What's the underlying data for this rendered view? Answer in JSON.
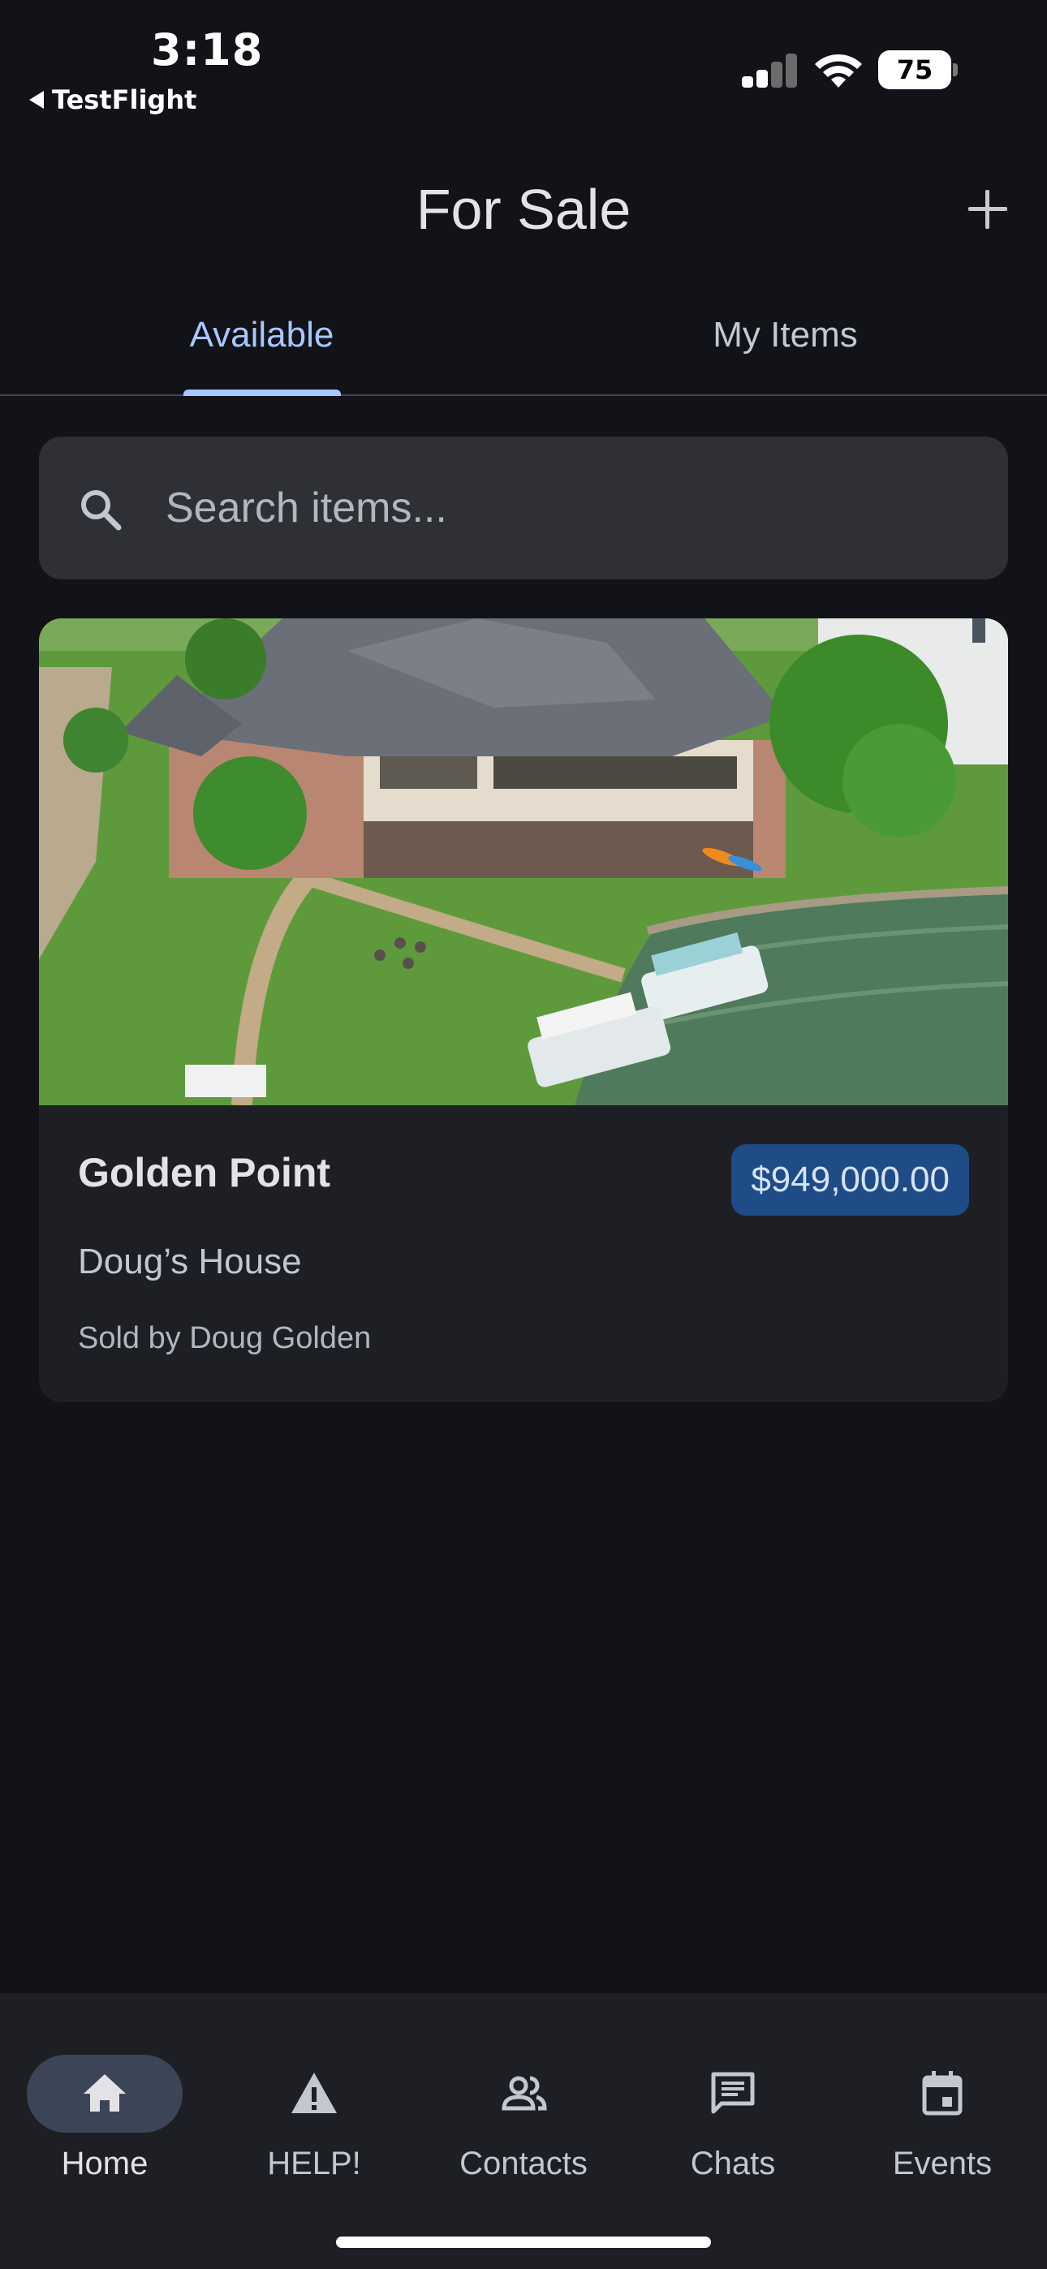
{
  "status_bar": {
    "time": "3:18",
    "back_app": "TestFlight",
    "battery": "75"
  },
  "header": {
    "title": "For Sale",
    "add_icon": "plus-icon"
  },
  "tabs": [
    {
      "label": "Available",
      "selected": true
    },
    {
      "label": "My Items",
      "selected": false
    }
  ],
  "search": {
    "placeholder": "Search items...",
    "value": "",
    "icon": "search-icon"
  },
  "listing": {
    "title": "Golden Point",
    "price": "$949,000.00",
    "subtitle": "Doug’s House",
    "seller": "Sold by Doug Golden"
  },
  "bottom_nav": [
    {
      "label": "Home",
      "icon": "home-icon",
      "active": true
    },
    {
      "label": "HELP!",
      "icon": "warning-icon",
      "active": false
    },
    {
      "label": "Contacts",
      "icon": "contacts-icon",
      "active": false
    },
    {
      "label": "Chats",
      "icon": "chat-icon",
      "active": false
    },
    {
      "label": "Events",
      "icon": "calendar-icon",
      "active": false
    }
  ],
  "colors": {
    "background": "#121318",
    "accent": "#a9c7ff",
    "price_badge": "#1f4b86",
    "card": "#1d1f25"
  }
}
